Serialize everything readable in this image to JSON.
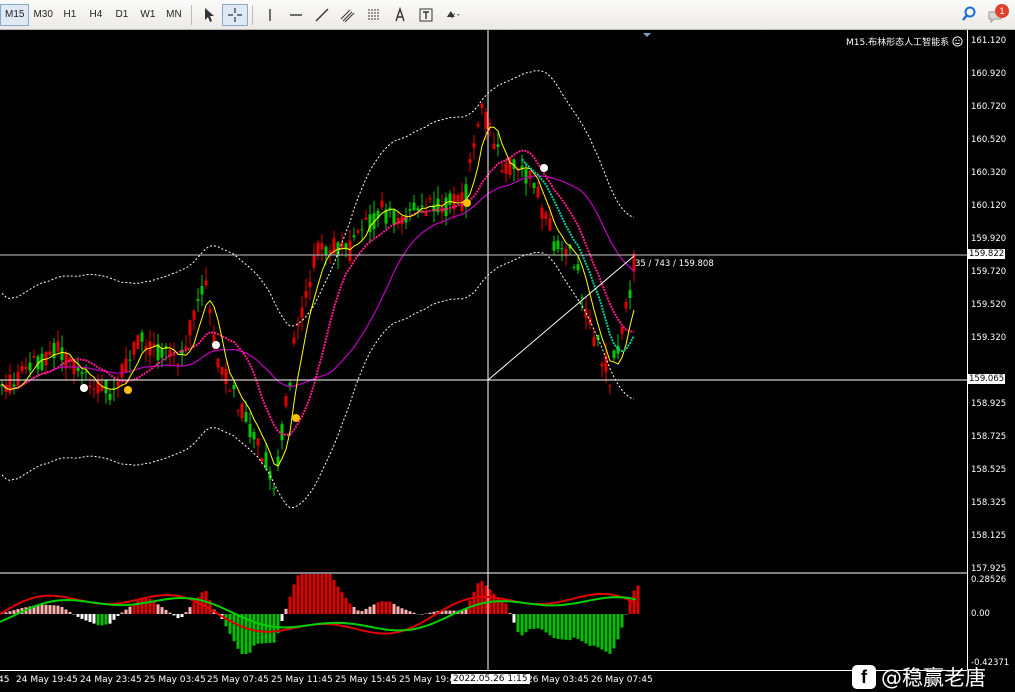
{
  "toolbar": {
    "timeframes": [
      "M15",
      "M30",
      "H1",
      "H4",
      "D1",
      "W1",
      "MN"
    ],
    "active_timeframe": "M15",
    "notification_count": "1"
  },
  "chart": {
    "indicator_title": "M15.布林形态人工智能系",
    "price_labels": [
      {
        "text": "161.120"
      },
      {
        "text": "160.920"
      },
      {
        "text": "160.720"
      },
      {
        "text": "160.520"
      },
      {
        "text": "160.320"
      },
      {
        "text": "160.120"
      },
      {
        "text": "159.920"
      },
      {
        "text": "159.720"
      },
      {
        "text": "159.520"
      },
      {
        "text": "159.320"
      },
      {
        "text": "159.120"
      },
      {
        "text": "158.925"
      },
      {
        "text": "158.725"
      },
      {
        "text": "158.525"
      },
      {
        "text": "158.325"
      },
      {
        "text": "158.125"
      },
      {
        "text": "157.925"
      }
    ],
    "current_price": "159.822",
    "crosshair_price": "159.065",
    "measure_text": "35 / 743 / 159.808",
    "time_labels": [
      "45",
      "24 May 19:45",
      "24 May 23:45",
      "25 May 03:45",
      "25 May 07:45",
      "25 May 11:45",
      "25 May 15:45",
      "25 May 19:4",
      "",
      "26 May 03:45",
      "26 May 07:45"
    ],
    "crosshair_time": "2022.05.26 1:15",
    "osc_labels": [
      "0.28526",
      "0.00",
      "-0.42371"
    ],
    "colors": {
      "bull": "#00c800",
      "bear": "#e00000",
      "band": "#ffffff",
      "ma_fast": "#ffff00",
      "ma_pink": "#ff1a8c",
      "ma_magenta": "#c000c0",
      "teal": "#00d0a0"
    }
  },
  "watermark": {
    "text": "@稳赢老唐",
    "logo": "f"
  }
}
